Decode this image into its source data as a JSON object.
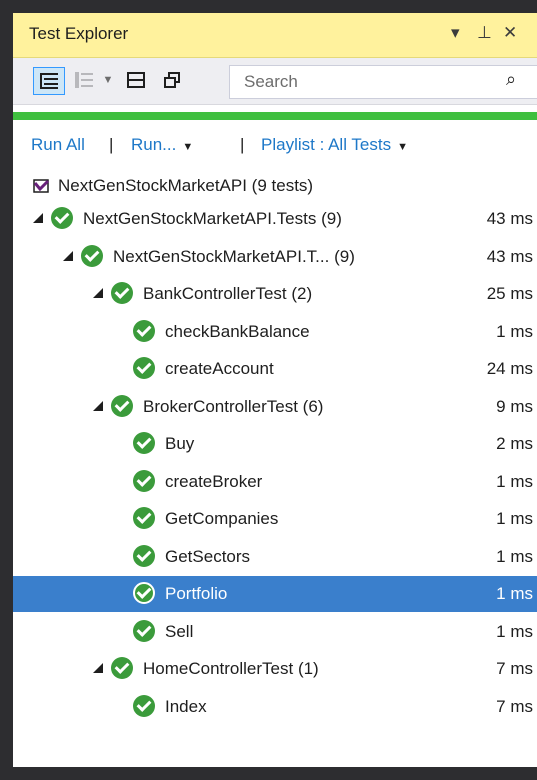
{
  "window": {
    "title": "Test Explorer",
    "dropdown_icon": "caret-down",
    "pin_icon": "pin",
    "close_icon": "close"
  },
  "toolbar": {
    "tools": [
      "group-by-hierarchy-icon",
      "group-by-list-icon",
      "chevron-down-icon",
      "playlist-icon",
      "copy-icon"
    ]
  },
  "search": {
    "placeholder": "Search",
    "value": ""
  },
  "progress": {
    "value": 1.0,
    "color": "#3fbf3f"
  },
  "commands": {
    "run_all": "Run All",
    "run": "Run...",
    "playlist": "Playlist : All Tests",
    "separator": "|"
  },
  "project": {
    "label": "NextGenStockMarketAPI (9 tests)",
    "icon": "vs-project-icon"
  },
  "colors": {
    "accent": "#3a7fcc",
    "pass": "#3b9b3b",
    "link": "#1e78c8",
    "title_bar": "#fff29d"
  },
  "tests": [
    {
      "label": "NextGenStockMarketAPI.Tests (9)",
      "duration": "43 ms",
      "depth": 0,
      "expanded": true,
      "status": "passed"
    },
    {
      "label": "NextGenStockMarketAPI.T... (9)",
      "duration": "43 ms",
      "depth": 1,
      "expanded": true,
      "status": "passed"
    },
    {
      "label": "BankControllerTest (2)",
      "duration": "25 ms",
      "depth": 2,
      "expanded": true,
      "status": "passed"
    },
    {
      "label": "checkBankBalance",
      "duration": "1 ms",
      "depth": 3,
      "status": "passed"
    },
    {
      "label": "createAccount",
      "duration": "24 ms",
      "depth": 3,
      "status": "passed"
    },
    {
      "label": "BrokerControllerTest (6)",
      "duration": "9 ms",
      "depth": 2,
      "expanded": true,
      "status": "passed"
    },
    {
      "label": "Buy",
      "duration": "2 ms",
      "depth": 3,
      "status": "passed"
    },
    {
      "label": "createBroker",
      "duration": "1 ms",
      "depth": 3,
      "status": "passed"
    },
    {
      "label": "GetCompanies",
      "duration": "1 ms",
      "depth": 3,
      "status": "passed"
    },
    {
      "label": "GetSectors",
      "duration": "1 ms",
      "depth": 3,
      "status": "passed"
    },
    {
      "label": "Portfolio",
      "duration": "1 ms",
      "depth": 3,
      "status": "passed",
      "selected": true
    },
    {
      "label": "Sell",
      "duration": "1 ms",
      "depth": 3,
      "status": "passed"
    },
    {
      "label": "HomeControllerTest (1)",
      "duration": "7 ms",
      "depth": 2,
      "expanded": true,
      "status": "passed"
    },
    {
      "label": "Index",
      "duration": "7 ms",
      "depth": 3,
      "status": "passed"
    }
  ]
}
